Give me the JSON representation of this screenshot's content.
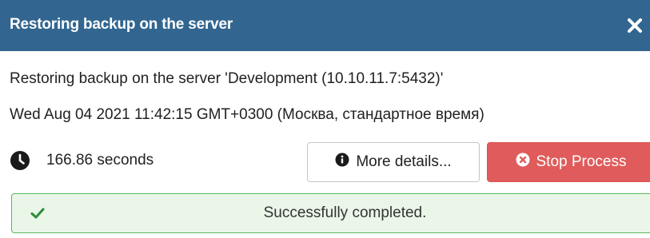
{
  "dialog": {
    "title": "Restoring backup on the server",
    "close_icon": "close-icon"
  },
  "body": {
    "description": "Restoring backup on the server 'Development (10.10.11.7:5432)'",
    "start_time": "Wed Aug 04 2021 11:42:15 GMT+0300 (Москва, стандартное время)",
    "elapsed": "166.86 seconds",
    "clock_icon": "clock-icon"
  },
  "buttons": {
    "details_label": "More details...",
    "details_icon": "info-icon",
    "stop_label": "Stop Process",
    "stop_icon": "times-circle-icon"
  },
  "status": {
    "message": "Successfully completed.",
    "icon": "check-icon"
  },
  "colors": {
    "header": "#326690",
    "stop_button": "#e05b5b",
    "success_border": "#5cb85c",
    "success_background": "#e9f6e8"
  }
}
